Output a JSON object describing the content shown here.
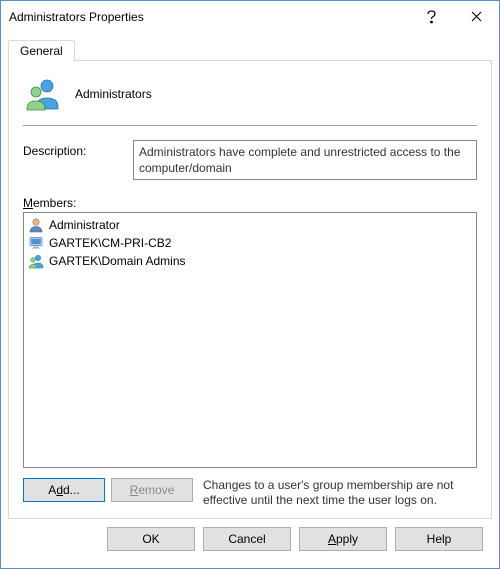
{
  "title": "Administrators Properties",
  "tabs": {
    "general": "General"
  },
  "group_name": "Administrators",
  "description": {
    "label": "Description:",
    "value": "Administrators have complete and unrestricted access to the computer/domain"
  },
  "members": {
    "label_prefix_ul": "M",
    "label_rest": "embers:",
    "items": [
      {
        "icon": "user-icon",
        "name": "Administrator"
      },
      {
        "icon": "computer-icon",
        "name": "GARTEK\\CM-PRI-CB2"
      },
      {
        "icon": "group-icon",
        "name": "GARTEK\\Domain Admins"
      }
    ]
  },
  "buttons": {
    "add_ul": "d",
    "add_pre": "A",
    "add_post": "d...",
    "remove_ul": "R",
    "remove_post": "emove",
    "ok": "OK",
    "cancel": "Cancel",
    "apply_ul": "A",
    "apply_post": "pply",
    "help": "Help"
  },
  "note": "Changes to a user's group membership are not effective until the next time the user logs on."
}
